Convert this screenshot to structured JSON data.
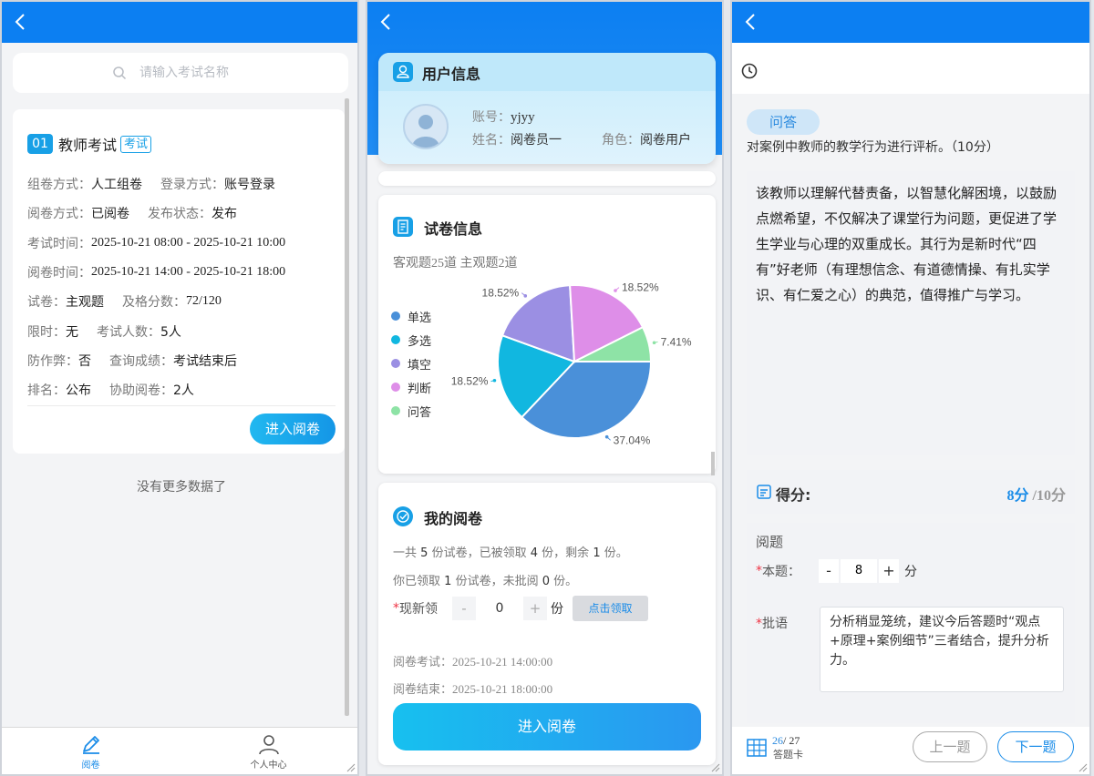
{
  "search": {
    "placeholder": "请输入考试名称"
  },
  "exam": {
    "number": "01",
    "name": "教师考试",
    "tag": "考试",
    "rows": [
      [
        {
          "k": "组卷方式：",
          "v": "人工组卷"
        },
        {
          "k": "登录方式：",
          "v": "账号登录"
        }
      ],
      [
        {
          "k": "阅卷方式：",
          "v": "已阅卷"
        },
        {
          "k": "发布状态：",
          "v": "发布"
        }
      ],
      [
        {
          "k": "考试时间：",
          "v": "2025-10-21 08:00 - 2025-10-21 10:00"
        }
      ],
      [
        {
          "k": "阅卷时间：",
          "v": "2025-10-21 14:00 - 2025-10-21 18:00"
        }
      ],
      [
        {
          "k": "试卷：",
          "v": "主观题"
        },
        {
          "k": "及格分数：",
          "v": "72/120"
        }
      ],
      [
        {
          "k": "限时：",
          "v": "无"
        },
        {
          "k": "考试人数：",
          "v": "5人"
        }
      ],
      [
        {
          "k": "防作弊：",
          "v": "否"
        },
        {
          "k": "查询成绩：",
          "v": "考试结束后"
        }
      ],
      [
        {
          "k": "排名：",
          "v": "公布"
        },
        {
          "k": "协助阅卷：",
          "v": "2人"
        }
      ]
    ],
    "enter_label": "进入阅卷"
  },
  "no_more": "没有更多数据了",
  "bottom_nav": {
    "items": [
      {
        "label": "阅卷"
      },
      {
        "label": "个人中心"
      }
    ]
  },
  "user_info": {
    "title": "用户信息",
    "account_key": "账号：",
    "account": "yjyy",
    "name_key": "姓名：",
    "name": "阅卷员一",
    "role_key": "角色：",
    "role": "阅卷用户"
  },
  "paper_info": {
    "title": "试卷信息",
    "summary": "客观题25道 主观题2道"
  },
  "chart_data": {
    "type": "pie",
    "categories": [
      "单选",
      "多选",
      "填空",
      "判断",
      "问答"
    ],
    "values": [
      37.04,
      18.52,
      18.52,
      18.52,
      7.41
    ],
    "labels": [
      "37.04%",
      "18.52%",
      "18.52%",
      "18.52%",
      "7.41%"
    ],
    "colors": [
      "#4a90d9",
      "#11b7e0",
      "#9b8fe3",
      "#de8ee8",
      "#8ee3a6"
    ],
    "legend_position": "left"
  },
  "my_review": {
    "title": "我的阅卷",
    "line1_a": "一共",
    "line1_total": "5",
    "line1_b": "份试卷，已被领取",
    "line1_taken": "4",
    "line1_c": "份，剩余",
    "line1_left": "1",
    "line1_d": "份。",
    "line2_a": "你已领取",
    "line2_got": "1",
    "line2_b": "份试卷，未批阅",
    "line2_unread": "0",
    "line2_c": "份。",
    "claim_label": "现新领",
    "claim_value": "0",
    "unit": "份",
    "minus": "-",
    "plus": "+",
    "claim_button": "点击领取",
    "start_time": "阅卷考试：2025-10-21 14:00:00",
    "end_time": "阅卷结束：2025-10-21 18:00:00",
    "enter_label": "进入阅卷"
  },
  "question": {
    "type_tag": "问答",
    "stem_partial": "对案例中教师的教学行为进行评析。（10分）",
    "answer": "该教师以理解代替责备，以智慧化解困境，以鼓励点燃希望，不仅解决了课堂行为问题，更促进了学生学业与心理的双重成长。其行为是新时代“四有”好老师（有理想信念、有道德情操、有扎实学识、有仁爱之心）的典范，值得推广与学习。"
  },
  "score": {
    "label": "得分:",
    "got": "8分",
    "total": "/10分"
  },
  "review": {
    "title": "阅题",
    "this_label": "本题：",
    "minus": "-",
    "plus": "+",
    "value": "8",
    "unit": "分",
    "comment_label": "批语",
    "comment": "分析稍显笼统，建议今后答题时“观点+原理+案例细节”三者结合，提升分析力。"
  },
  "answer_card": {
    "current": "26",
    "total": "/ 27",
    "label": "答题卡"
  },
  "nav_buttons": {
    "prev": "上一题",
    "next": "下一题"
  }
}
